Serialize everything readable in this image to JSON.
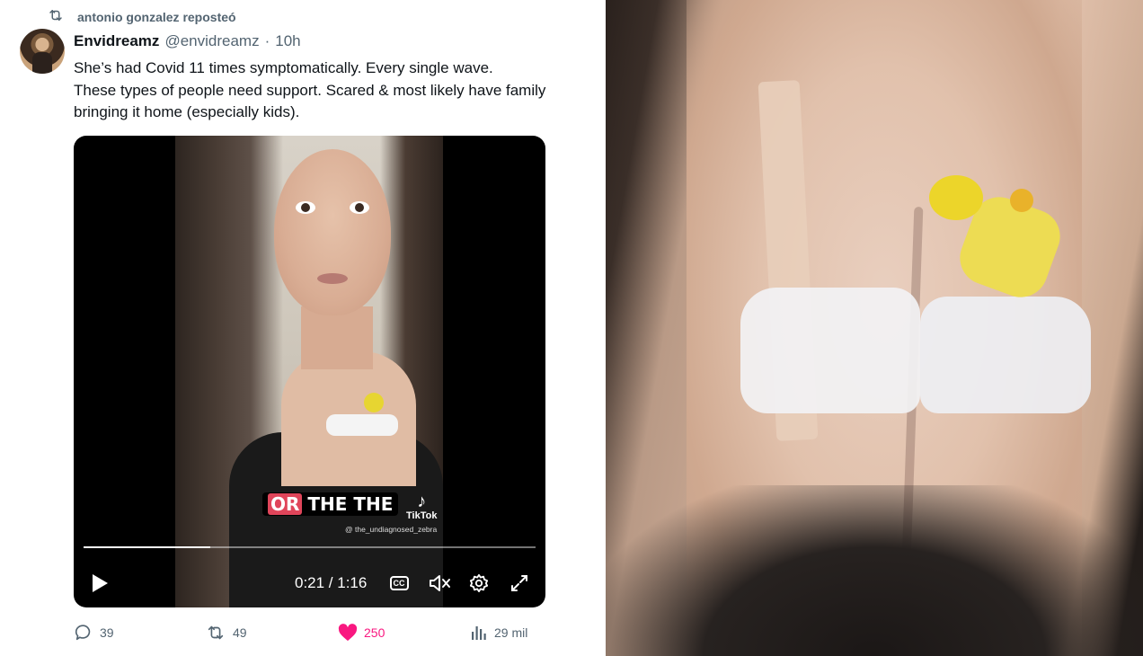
{
  "repost": {
    "label": "antonio gonzalez reposteó",
    "icon": "retweet-icon"
  },
  "tweet": {
    "author_name": "Envidreamz",
    "handle": "@envidreamz",
    "separator": "·",
    "time": "10h",
    "text_lines": [
      "She’s had Covid 11 times symptomatically. Every single wave.",
      "These types of people need support. Scared & most likely have family bringing it home (especially kids)."
    ]
  },
  "video": {
    "caption_highlight": "OR",
    "caption_rest": "THE THE",
    "watermark_brand": "TikTok",
    "watermark_user": "@ the_undiagnosed_zebra",
    "progress_fraction": 0.28,
    "time_readout": "0:21 / 1:16",
    "cc_label": "CC"
  },
  "actions": {
    "replies": "39",
    "reposts": "49",
    "likes": "250",
    "views": "29 mil"
  },
  "colors": {
    "text_primary": "#0f1419",
    "text_secondary": "#536471",
    "like_pink": "#f91880",
    "video_bg": "#000000"
  }
}
